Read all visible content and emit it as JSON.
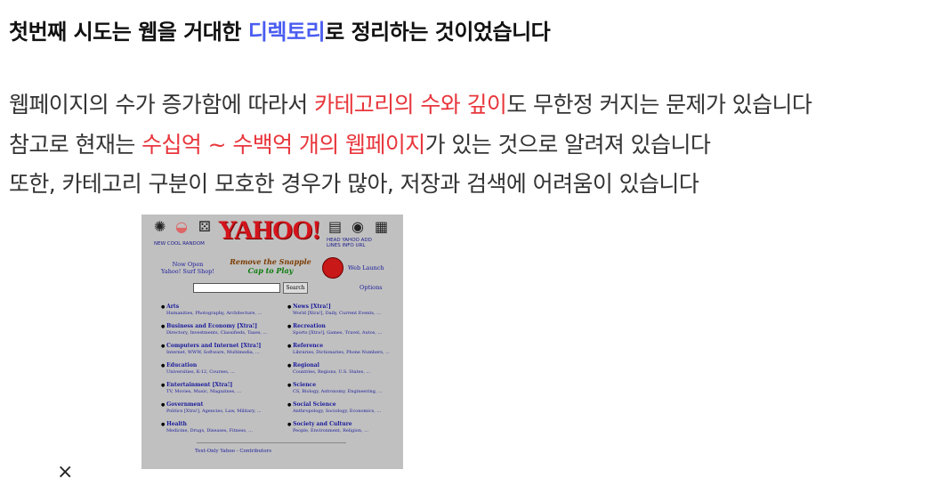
{
  "heading": {
    "part1": "첫번째 시도는 웹을 거대한 ",
    "highlight": "디렉토리",
    "part2": "로 정리하는 것이었습니다"
  },
  "lines": [
    {
      "pre": "웹페이지의 수가 증가함에 따라서 ",
      "red": "카테고리의 수와 깊이",
      "post": "도 무한정 커지는 문제가 있습니다"
    },
    {
      "pre": "참고로 현재는 ",
      "red": "수십억 ~ 수백억 개의 웹페이지",
      "post": "가 있는 것으로 알려져 있습니다"
    },
    {
      "pre": "또한, 카테고리 구분이 모호한 경우가 많아, 저장과 검색에 어려움이 있습니다",
      "red": "",
      "post": ""
    }
  ],
  "yahoo": {
    "logo": "YAHOO!",
    "nav_left": "NEW  COOL  RANDOM",
    "nav_right": "HEAD  YAHOO  ADD",
    "nav_right2": "LINES  INFO  URL",
    "left_link": "Now Open\nYahoo! Surf Shop!",
    "right_link": "Web Launch",
    "banner_line1": "Remove the Snapple",
    "banner_line2": "Cap to Play",
    "search_button": "Search",
    "options": "Options",
    "categories": [
      {
        "title": "Arts",
        "sub": "Humanities, Photography, Architecture, ..."
      },
      {
        "title": "News [Xtra!]",
        "sub": "World [Xtra!], Daily, Current Events, ..."
      },
      {
        "title": "Business and Economy [Xtra!]",
        "sub": "Directory, Investments, Classifieds, Taxes, ..."
      },
      {
        "title": "Recreation",
        "sub": "Sports [Xtra!], Games, Travel, Autos, ..."
      },
      {
        "title": "Computers and Internet [Xtra!]",
        "sub": "Internet, WWW, Software, Multimedia, ..."
      },
      {
        "title": "Reference",
        "sub": "Libraries, Dictionaries, Phone Numbers, ..."
      },
      {
        "title": "Education",
        "sub": "Universities, K-12, Courses, ..."
      },
      {
        "title": "Regional",
        "sub": "Countries, Regions, U.S. States, ..."
      },
      {
        "title": "Entertainment [Xtra!]",
        "sub": "TV, Movies, Music, Magazines, ..."
      },
      {
        "title": "Science",
        "sub": "CS, Biology, Astronomy, Engineering, ..."
      },
      {
        "title": "Government",
        "sub": "Politics [Xtra!], Agencies, Law, Military, ..."
      },
      {
        "title": "Social Science",
        "sub": "Anthropology, Sociology, Economics, ..."
      },
      {
        "title": "Health",
        "sub": "Medicine, Drugs, Diseases, Fitness, ..."
      },
      {
        "title": "Society and Culture",
        "sub": "People, Environment, Religion, ..."
      }
    ],
    "footer": "Text-Only Yahoo  -  Contributors"
  },
  "close_label": "×",
  "colors": {
    "highlight_blue": "#4a5cf0",
    "highlight_red": "#e8363c",
    "yahoo_bg": "#c0c0c0"
  }
}
